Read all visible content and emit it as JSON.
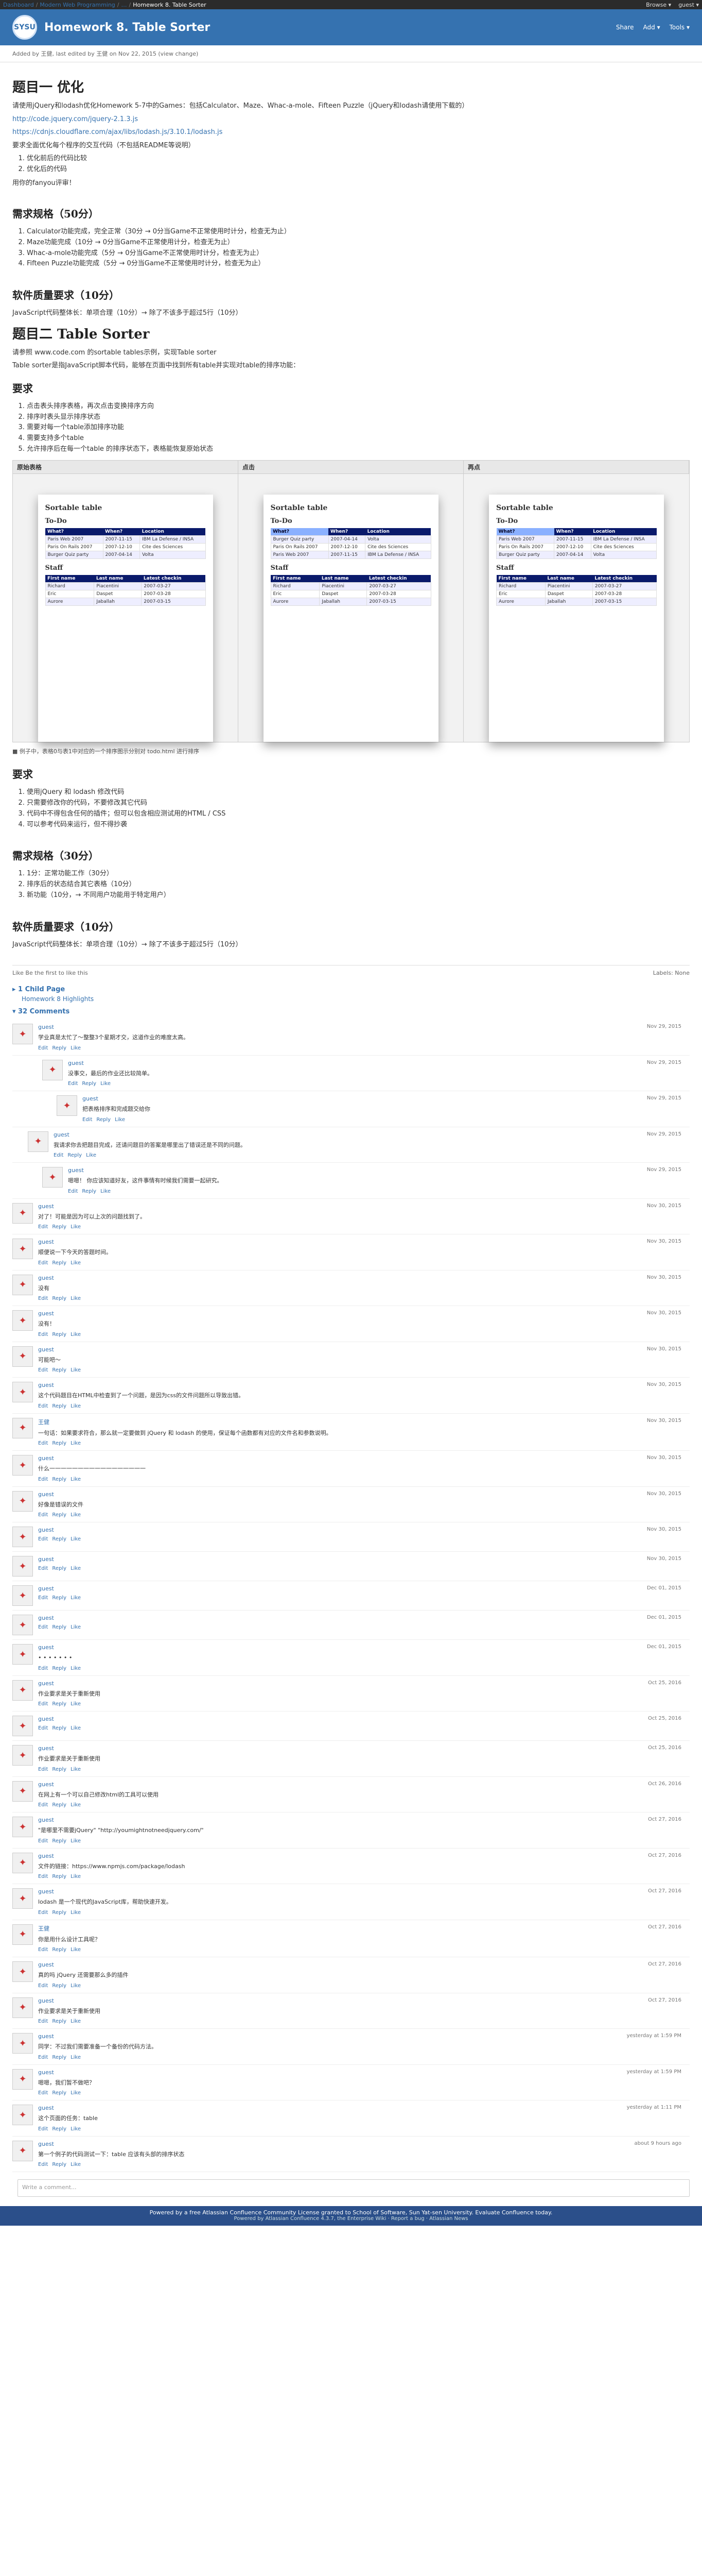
{
  "topbar": {
    "breadcrumbs": [
      "Dashboard",
      "Modern Web Programming",
      "…",
      "Homework 8. Table Sorter"
    ],
    "right": [
      "Browse ▾",
      "guest ▾"
    ]
  },
  "header": {
    "title": "Homework 8. Table Sorter",
    "actions": [
      "Share",
      "Add ▾",
      "Tools ▾"
    ]
  },
  "meta": {
    "text": "Added by 王健, last edited by 王健 on Nov 22, 2015 (view change)"
  },
  "content": {
    "h_section1": "题目一  优化",
    "p1": "请使用jQuery和lodash优化Homework 5-7中的Games：包括Calculator、Maze、Whac-a-mole、Fifteen Puzzle（jQuery和lodash请使用下载的）",
    "links": [
      "http://code.jquery.com/jquery-2.1.3.js",
      "https://cdnjs.cloudflare.com/ajax/libs/lodash.js/3.10.1/lodash.js"
    ],
    "p2": "要求全面优化每个程序的交互代码（不包括README等说明）",
    "list1": [
      "优化前后的代码比较",
      "优化后的代码"
    ],
    "p3": "用你的fanyou评审！",
    "h_req": "需求规格（50分）",
    "req_list": [
      "Calculator功能完成，完全正常（30分 → 0分当Game不正常使用时计分，检查无为止）",
      "Maze功能完成（10分 → 0分当Game不正常使用计分，检查无为止）",
      "Whac-a-mole功能完成（5分 → 0分当Game不正常使用时计分，检查无为止）",
      "Fifteen Puzzle功能完成（5分 → 0分当Game不正常使用时计分，检查无为止）"
    ],
    "h_quality": "软件质量要求（10分）",
    "quality_text": "JavaScript代码整体长：单项合理（10分）→ 除了不该多于超过5行（10分）",
    "h_section2": "题目二  Table Sorter",
    "p4": "请参照 www.code.com 的sortable tables示例，实现Table sorter",
    "p5": "Table sorter是指JavaScript脚本代码，能够在页面中找到所有table并实现对table的排序功能：",
    "h_req2": "要求",
    "req2_list": [
      "点击表头排序表格，再次点击变换排序方向",
      "排序时表头显示排序状态",
      "需要对每一个table添加排序功能",
      "需要支持多个table",
      "允许排序后在每一个table 的排序状态下，表格能恢复原始状态"
    ],
    "showcase_headers": [
      "原始表格",
      "点击",
      "再点"
    ],
    "showcase_caption": "■ 例子中，表格0与表1中对应的一个排序图示分别对 todo.html 进行排序",
    "h_req3": "要求",
    "req3_list": [
      "使用jQuery 和 lodash 修改代码",
      "只需要修改你的代码，不要修改其它代码",
      "代码中不得包含任何的插件；但可以包含相应测试用的HTML / CSS",
      "可以参考代码来运行，但不得抄袭"
    ],
    "h_req4": "需求规格（30分）",
    "req4_list": [
      "1分：正常功能工作（30分）",
      "排序后的状态结合其它表格（10分）",
      "新功能（10分，→ 不同用户功能用于特定用户）"
    ],
    "h_quality2": "软件质量要求（10分）",
    "quality2_text": "JavaScript代码整体长：单项合理（10分）→ 除了不该多于超过5行（10分）"
  },
  "card": {
    "title": "Sortable table",
    "todo": "To-Do",
    "staff": "Staff",
    "todo_headers": [
      "What?",
      "When?",
      "Location"
    ],
    "todo_rows": [
      [
        "Paris Web 2007",
        "2007-11-15",
        "IBM La Defense / INSA"
      ],
      [
        "Paris On Rails 2007",
        "2007-12-10",
        "Cite des Sciences"
      ],
      [
        "Burger Quiz party",
        "2007-04-14",
        "Volta"
      ]
    ],
    "staff_headers": [
      "First name",
      "Last name",
      "Latest checkin"
    ],
    "staff_rows": [
      [
        "Richard",
        "Piacentini",
        "2007-03-27"
      ],
      [
        "Eric",
        "Daspet",
        "2007-03-28"
      ],
      [
        "Aurore",
        "Jaballah",
        "2007-03-15"
      ]
    ]
  },
  "footline": {
    "like": "Like   Be the first to like this",
    "labels": "Labels: None"
  },
  "child_pages": {
    "toggle": "▸ 1 Child Page",
    "link": "Homework 8 Highlights"
  },
  "comments_header": "▾ 32 Comments",
  "comments": [
    {
      "author": "guest",
      "text": "学业真是太忙了～整整3个星期才交，这道作业的难度太高。",
      "date": "Nov 29, 2015"
    },
    {
      "author": "guest",
      "text": "没事交，最后的作业还比较简单。",
      "date": "Nov 29, 2015"
    },
    {
      "author": "guest",
      "text": "把表格排序和完成题交给你",
      "date": "Nov 29, 2015"
    },
    {
      "author": "guest",
      "text": "我请求你去把题目完成，还请问题目的答案是哪里出了错误还是不同的问题。",
      "date": "Nov 29, 2015"
    },
    {
      "author": "guest",
      "text": "嗯嗯！ 你应该知道好友，这件事情有时候我们需要一起研究。",
      "date": "Nov 29, 2015"
    },
    {
      "author": "guest",
      "text": "对了！可能是因为可以上次的问题找到了。",
      "date": "Nov 30, 2015"
    },
    {
      "author": "guest",
      "text": "顺便说一下今天的答题时间。",
      "date": "Nov 30, 2015"
    },
    {
      "author": "guest",
      "text": "没有",
      "date": "Nov 30, 2015"
    },
    {
      "author": "guest",
      "text": "没有！",
      "date": "Nov 30, 2015"
    },
    {
      "author": "guest",
      "text": "可能吧～",
      "date": "Nov 30, 2015"
    },
    {
      "author": "guest",
      "text": "这个代码题目在HTML中检查到了一个问题，是因为css的文件问题所以导致出错。",
      "date": "Nov 30, 2015"
    },
    {
      "author": "王健",
      "text": "一句话：如果要求符合，那么就一定要做到 jQuery 和 lodash 的使用，保证每个函数都有对应的文件名和参数说明。",
      "date": "Nov 30, 2015"
    },
    {
      "author": "guest",
      "text": "什么一一一一一一一一一一一一一一一一一",
      "date": "Nov 30, 2015"
    },
    {
      "author": "guest",
      "text": "好像是错误的文件",
      "date": "Nov 30, 2015"
    },
    {
      "author": "guest",
      "text": "",
      "date": "Nov 30, 2015"
    },
    {
      "author": "guest",
      "text": "",
      "date": "Nov 30, 2015"
    },
    {
      "author": "guest",
      "text": "",
      "date": "Dec 01, 2015"
    },
    {
      "author": "guest",
      "text": "",
      "date": "Dec 01, 2015"
    },
    {
      "author": "guest",
      "text": "• • • • • • •",
      "date": "Dec 01, 2015"
    },
    {
      "author": "guest",
      "text": "作业要求是关于重新使用",
      "date": "Oct 25, 2016"
    },
    {
      "author": "guest",
      "text": "",
      "date": "Oct 25, 2016"
    },
    {
      "author": "guest",
      "text": "作业要求是关于重新使用",
      "date": "Oct 25, 2016"
    },
    {
      "author": "guest",
      "text": "在网上有一个可以自己修改html的工具可以使用",
      "date": "Oct 26, 2016"
    },
    {
      "author": "guest",
      "text": "\"是哪里不需要jQuery\" \"http://youmightnotneedjquery.com/\"",
      "date": "Oct 27, 2016"
    },
    {
      "author": "guest",
      "text": "文件的链接：https://www.npmjs.com/package/lodash",
      "date": "Oct 27, 2016"
    },
    {
      "author": "guest",
      "text": "lodash 是一个现代的JavaScript库，帮助快速开发。",
      "date": "Oct 27, 2016"
    },
    {
      "author": "王健",
      "text": "你是用什么设计工具呢？",
      "date": "Oct 27, 2016"
    },
    {
      "author": "guest",
      "text": "真的吗 jQuery 还需要那么多的插件",
      "date": "Oct 27, 2016"
    },
    {
      "author": "guest",
      "text": "作业要求是关于重新使用",
      "date": "Oct 27, 2016"
    },
    {
      "author": "guest",
      "text": "同学：不过我们需要准备一个备份的代码方法。",
      "date": "yesterday at 1:59 PM"
    },
    {
      "author": "guest",
      "text": "嗯嗯，我们暂不做吧？",
      "date": "yesterday at 1:59 PM"
    },
    {
      "author": "guest",
      "text": "这个页面的任务：table",
      "date": "yesterday at 1:11 PM"
    },
    {
      "author": "guest",
      "text": "第一个例子的代码测试一下：table 应该有头部的排序状态",
      "date": "about 9 hours ago"
    }
  ],
  "comment_actions": [
    "Edit",
    "Reply",
    "Like"
  ],
  "add_comment_placeholder": "Write a comment...",
  "footer": {
    "main": "Powered by a free Atlassian Confluence Community License granted to School of Software, Sun Yat-sen University. Evaluate Confluence today.",
    "sub": "Powered by Atlassian Confluence 4.3.7, the Enterprise Wiki  ·  Report a bug  ·  Atlassian News"
  }
}
